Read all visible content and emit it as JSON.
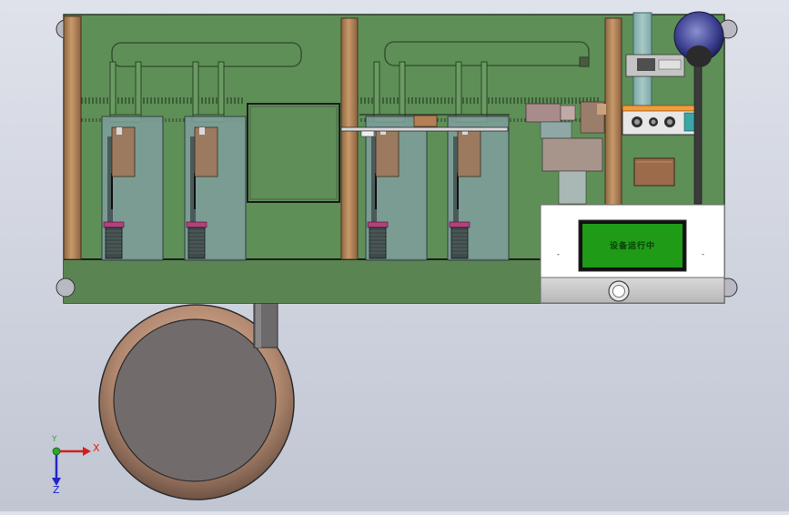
{
  "screen": {
    "text": "设备运行中",
    "color": "#1f9b17"
  },
  "triad": {
    "x_label": "X",
    "y_label": "Y",
    "z_label": "Z"
  },
  "colors": {
    "base_plate": "#5d8f56",
    "wood_post": "#b98a5b",
    "hmi_panel": "#ffffff",
    "glass": "#9fbfbf",
    "disc": "#6f6a6a"
  }
}
